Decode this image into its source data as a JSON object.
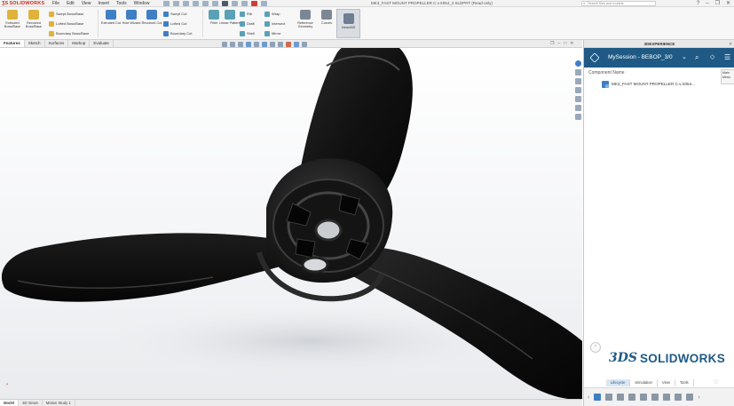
{
  "app": {
    "logo_text": "SOLIDWORKS",
    "menu": [
      "File",
      "Edit",
      "View",
      "Insert",
      "Tools",
      "Window"
    ],
    "document_title": "MK3_FAST MOUNT PROPELLER C.v.X054_2.SLDPRT (Read-only)",
    "search_placeholder": "Search files and models"
  },
  "ribbon": {
    "big_buttons": [
      {
        "label": "Extruded Boss/Base",
        "icon": "extrude-boss-icon",
        "color": "#e0b23a"
      },
      {
        "label": "Revolved Boss/Base",
        "icon": "revolve-boss-icon",
        "color": "#e0b23a"
      },
      {
        "label": "Extruded Cut",
        "icon": "extrude-cut-icon",
        "color": "#3f7fc4"
      },
      {
        "label": "Hole Wizard",
        "icon": "hole-wizard-icon",
        "color": "#3f7fc4"
      },
      {
        "label": "Revolved Cut",
        "icon": "revolve-cut-icon",
        "color": "#3f7fc4"
      },
      {
        "label": "Fillet",
        "icon": "fillet-icon",
        "color": "#5aa1b6"
      },
      {
        "label": "Linear Pattern",
        "icon": "linear-pattern-icon",
        "color": "#5aa1b6"
      },
      {
        "label": "Reference Geometry",
        "icon": "reference-geometry-icon",
        "color": "#7a8896"
      },
      {
        "label": "Curves",
        "icon": "curves-icon",
        "color": "#7a8896"
      }
    ],
    "small_buttons": [
      {
        "label": "Swept Boss/Base",
        "icon": "swept-boss-icon",
        "color": "#e0b23a"
      },
      {
        "label": "Lofted Boss/Base",
        "icon": "lofted-boss-icon",
        "color": "#e0b23a"
      },
      {
        "label": "Boundary Boss/Base",
        "icon": "boundary-boss-icon",
        "color": "#e0b23a"
      },
      {
        "label": "Swept Cut",
        "icon": "swept-cut-icon",
        "color": "#3f7fc4"
      },
      {
        "label": "Lofted Cut",
        "icon": "lofted-cut-icon",
        "color": "#3f7fc4"
      },
      {
        "label": "Boundary Cut",
        "icon": "boundary-cut-icon",
        "color": "#3f7fc4"
      },
      {
        "label": "Rib",
        "icon": "rib-icon",
        "color": "#5aa1b6"
      },
      {
        "label": "Draft",
        "icon": "draft-icon",
        "color": "#5aa1b6"
      },
      {
        "label": "Shell",
        "icon": "shell-icon",
        "color": "#5aa1b6"
      },
      {
        "label": "Wrap",
        "icon": "wrap-icon",
        "color": "#5aa1b6"
      },
      {
        "label": "Intersect",
        "icon": "intersect-icon",
        "color": "#5aa1b6"
      },
      {
        "label": "Mirror",
        "icon": "mirror-icon",
        "color": "#5aa1b6"
      }
    ],
    "instant3d_label": "Instant3D"
  },
  "command_tabs": [
    "Features",
    "Sketch",
    "Surfaces",
    "Markup",
    "Evaluate"
  ],
  "bottom_tabs": [
    "Model",
    "3D Views",
    "Motion Study 1"
  ],
  "panel": {
    "header": "3DEXPERIENCE",
    "session": "MySession - BEBOP_3/0",
    "column_header": "Component Name",
    "tooltip": "Main Menu",
    "component_name": "MK3_FAST MOUNT PROPELLER C.v.X054...",
    "brand_mark": "3DS",
    "brand": "SOLIDWORKS",
    "tabs": [
      "Lifecycle",
      "Simulation",
      "View",
      "Tools"
    ],
    "active_tab": "Lifecycle",
    "accent_color": "#1f5a86"
  }
}
